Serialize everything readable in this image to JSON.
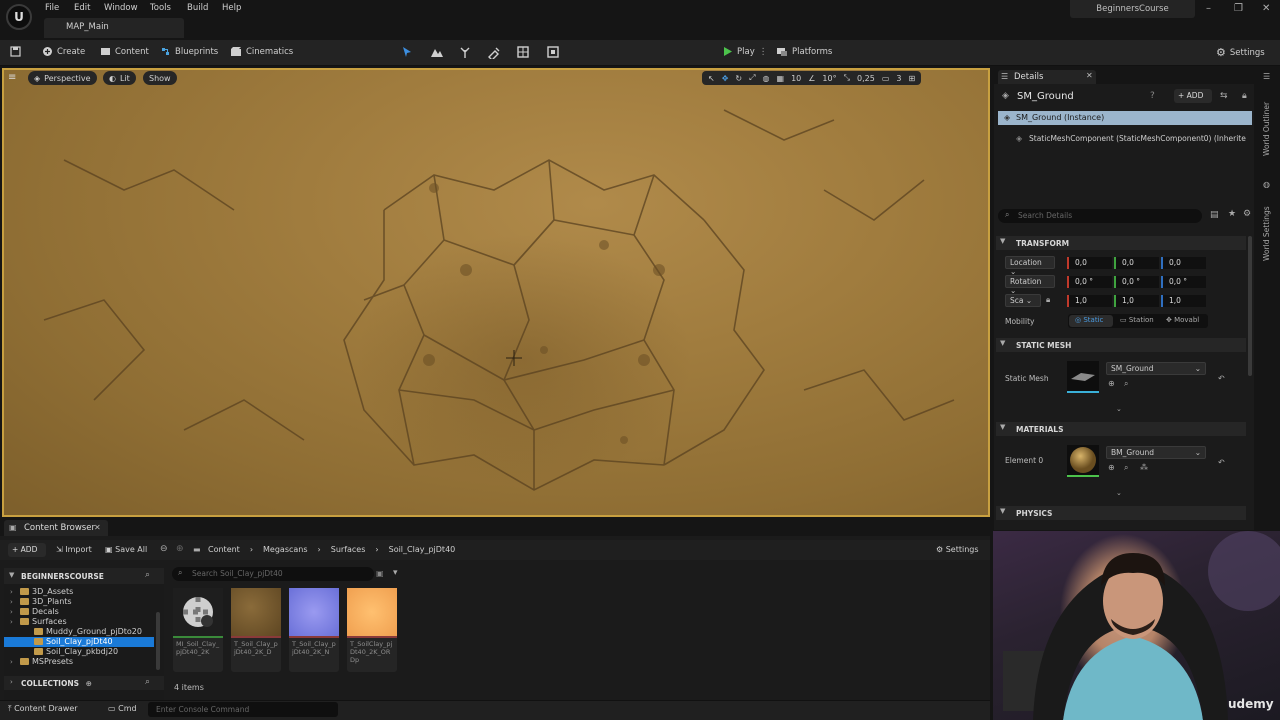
{
  "menu": [
    "File",
    "Edit",
    "Window",
    "Tools",
    "Build",
    "Help"
  ],
  "level_tab": "MAP_Main",
  "project_name": "BeginnersCourse",
  "toolbar": {
    "create": "Create",
    "content": "Content",
    "blueprints": "Blueprints",
    "cinematics": "Cinematics",
    "play": "Play",
    "platforms": "Platforms",
    "settings": "Settings"
  },
  "viewport": {
    "perspective": "Perspective",
    "lit": "Lit",
    "show": "Show",
    "grid_snap": "10",
    "rot_snap": "10°",
    "scale_snap": "0,25",
    "camera_speed": "3"
  },
  "details": {
    "tab": "Details",
    "actor_name": "SM_Ground",
    "add": "ADD",
    "instance_row": "SM_Ground (Instance)",
    "component_row": "StaticMeshComponent (StaticMeshComponent0) (Inherite",
    "search_placeholder": "Search Details",
    "transform_header": "TRANSFORM",
    "location_label": "Location",
    "rotation_label": "Rotation",
    "scale_label": "Sca",
    "location": [
      "0,0",
      "0,0",
      "0,0"
    ],
    "rotation": [
      "0,0 °",
      "0,0 °",
      "0,0 °"
    ],
    "scale": [
      "1,0",
      "1,0",
      "1,0"
    ],
    "mobility_label": "Mobility",
    "mobility_static": "Static",
    "mobility_station": "Station",
    "mobility_movable": "Movabl",
    "static_mesh_header": "STATIC MESH",
    "static_mesh_label": "Static Mesh",
    "static_mesh_value": "SM_Ground",
    "materials_header": "MATERIALS",
    "element_label": "Element 0",
    "material_value": "BM_Ground",
    "physics_header": "PHYSICS"
  },
  "side_tabs": [
    "World Outliner",
    "World Settings"
  ],
  "content_browser": {
    "tab": "Content Browser",
    "add": "ADD",
    "import": "Import",
    "save_all": "Save All",
    "breadcrumb": [
      "Content",
      "Megascans",
      "Surfaces",
      "Soil_Clay_pjDt40"
    ],
    "settings": "Settings",
    "root": "BEGINNERSCOURSE",
    "search_placeholder": "Search Soil_Clay_pjDt40",
    "tree": [
      {
        "label": "3D_Assets",
        "indent": 1
      },
      {
        "label": "3D_Plants",
        "indent": 1
      },
      {
        "label": "Decals",
        "indent": 1
      },
      {
        "label": "Surfaces",
        "indent": 1
      },
      {
        "label": "Muddy_Ground_pjDto20",
        "indent": 2
      },
      {
        "label": "Soil_Clay_pjDt40",
        "indent": 2,
        "selected": true
      },
      {
        "label": "Soil_Clay_pkbdj20",
        "indent": 2
      },
      {
        "label": "MSPresets",
        "indent": 1
      }
    ],
    "collections": "COLLECTIONS",
    "assets": [
      {
        "label": "MI_Soil_Clay_pjDt40_2K",
        "kind": "material"
      },
      {
        "label": "T_Soil_Clay_pjDt40_2K_D",
        "kind": "diffuse"
      },
      {
        "label": "T_Soil_Clay_pjDt40_2K_N",
        "kind": "normal"
      },
      {
        "label": "T_SoilClay_pjDt40_2K_ORDp",
        "kind": "orm"
      }
    ],
    "item_count": "4 items"
  },
  "status": {
    "content_drawer": "Content Drawer",
    "cmd": "Cmd",
    "console_placeholder": "Enter Console Command"
  },
  "watermark": "udemy"
}
